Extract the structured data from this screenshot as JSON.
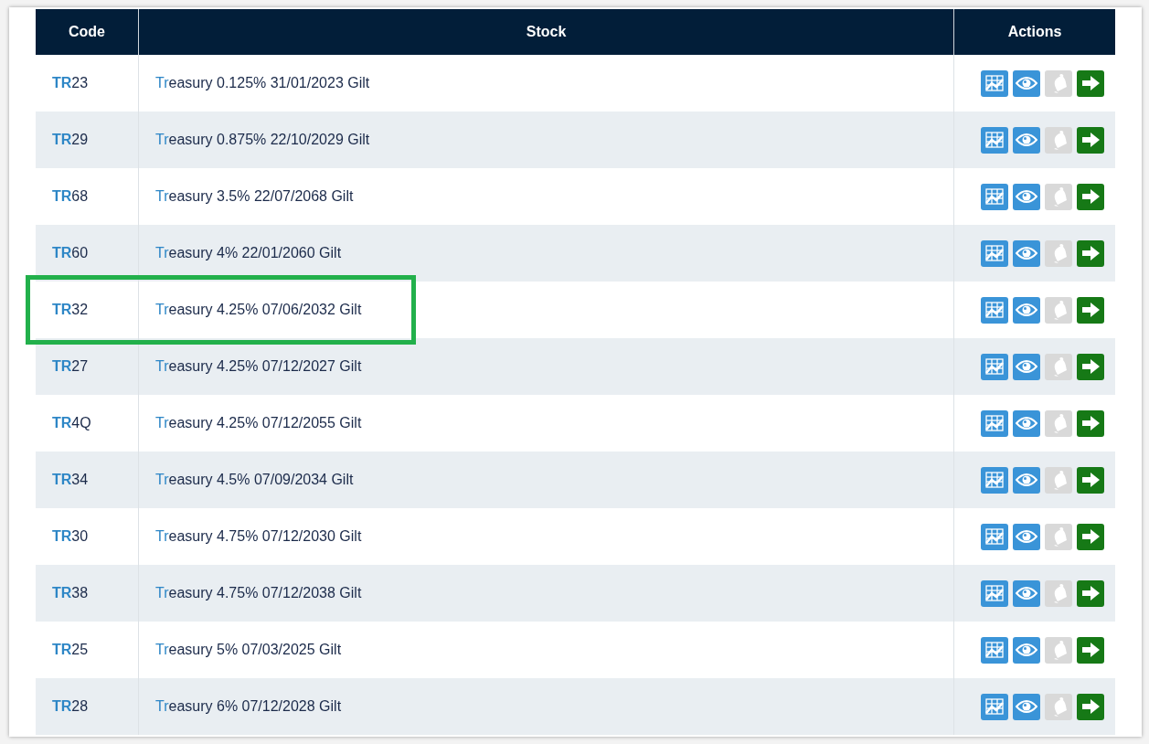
{
  "table": {
    "columns": [
      "Code",
      "Stock",
      "Actions"
    ],
    "rows": [
      {
        "code": "**TR**23",
        "stock": "**Tr**easury 0.125% 31/01/2023 Gilt",
        "highlighted": false,
        "alert_on": false
      },
      {
        "code": "**TR**29",
        "stock": "**Tr**easury 0.875% 22/10/2029 Gilt",
        "highlighted": false,
        "alert_on": false
      },
      {
        "code": "**TR**68",
        "stock": "**Tr**easury 3.5% 22/07/2068 Gilt",
        "highlighted": false,
        "alert_on": false
      },
      {
        "code": "**TR**60",
        "stock": "**Tr**easury 4% 22/01/2060 Gilt",
        "highlighted": false,
        "alert_on": false
      },
      {
        "code": "**TR**32",
        "stock": "**Tr**easury 4.25% 07/06/2032 Gilt",
        "highlighted": true,
        "alert_on": false
      },
      {
        "code": "**TR**27",
        "stock": "**Tr**easury 4.25% 07/12/2027 Gilt",
        "highlighted": false,
        "alert_on": false
      },
      {
        "code": "**TR**4Q",
        "stock": "**Tr**easury 4.25% 07/12/2055 Gilt",
        "highlighted": false,
        "alert_on": false
      },
      {
        "code": "**TR**34",
        "stock": "**Tr**easury 4.5% 07/09/2034 Gilt",
        "highlighted": false,
        "alert_on": false
      },
      {
        "code": "**TR**30",
        "stock": "**Tr**easury 4.75% 07/12/2030 Gilt",
        "highlighted": false,
        "alert_on": false
      },
      {
        "code": "**TR**38",
        "stock": "**Tr**easury 4.75% 07/12/2038 Gilt",
        "highlighted": false,
        "alert_on": false
      },
      {
        "code": "**TR**25",
        "stock": "**Tr**easury 5% 07/03/2025 Gilt",
        "highlighted": false,
        "alert_on": false
      },
      {
        "code": "**TR**28",
        "stock": "**Tr**easury 6% 07/12/2028 Gilt",
        "highlighted": false,
        "alert_on": false
      }
    ]
  }
}
